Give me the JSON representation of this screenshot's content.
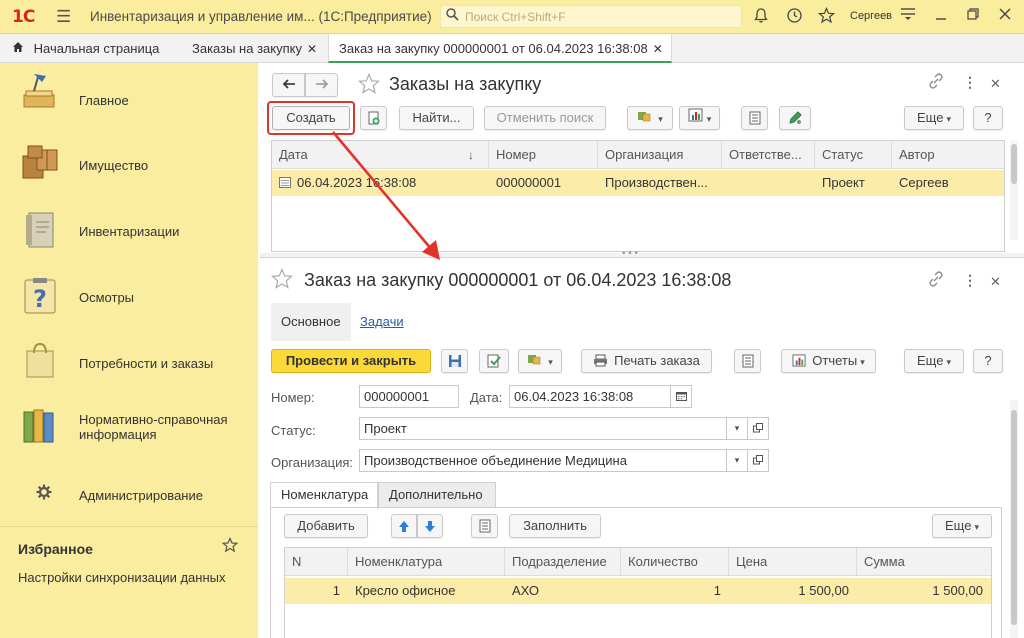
{
  "topbar": {
    "logo": "1С",
    "title": "Инвентаризация и управление им...  (1С:Предприятие)",
    "search_placeholder": "Поиск Ctrl+Shift+F",
    "user": "Сергеев"
  },
  "tabs": [
    {
      "label": "Начальная страница"
    },
    {
      "label": "Заказы на закупку"
    },
    {
      "label": "Заказ на закупку 000000001 от 06.04.2023 16:38:08"
    }
  ],
  "sidebar": {
    "items": [
      {
        "label": "Главное",
        "icon": "desk-lamp-icon"
      },
      {
        "label": "Имущество",
        "icon": "boxes-icon"
      },
      {
        "label": "Инвентаризации",
        "icon": "binder-icon"
      },
      {
        "label": "Осмотры",
        "icon": "question-clipboard-icon"
      },
      {
        "label": "Потребности и заказы",
        "icon": "shopping-bag-icon"
      },
      {
        "label": "Нормативно-справочная информация",
        "icon": "folders-icon"
      },
      {
        "label": "Администрирование",
        "icon": "gear-icon"
      }
    ],
    "favorites_title": "Избранное",
    "favorites_link": "Настройки синхронизации данных"
  },
  "list_form": {
    "title": "Заказы на закупку",
    "create_label": "Создать",
    "find_label": "Найти...",
    "cancel_search_label": "Отменить поиск",
    "more_label": "Еще",
    "help_label": "?",
    "columns": [
      "Дата",
      "Номер",
      "Организация",
      "Ответстве...",
      "Статус",
      "Автор"
    ],
    "rows": [
      [
        "06.04.2023 16:38:08",
        "000000001",
        "Производствен...",
        "",
        "Проект",
        "Сергеев"
      ]
    ]
  },
  "doc_form": {
    "title": "Заказ на закупку 000000001 от 06.04.2023 16:38:08",
    "nav_main": "Основное",
    "nav_tasks": "Задачи",
    "post_close_label": "Провести и закрыть",
    "print_label": "Печать заказа",
    "reports_label": "Отчеты",
    "more_label": "Еще",
    "help_label": "?",
    "number_label": "Номер:",
    "number_value": "000000001",
    "date_label": "Дата:",
    "date_value": "06.04.2023 16:38:08",
    "status_label": "Статус:",
    "status_value": "Проект",
    "org_label": "Организация:",
    "org_value": "Производственное объединение Медицина",
    "subtabs": [
      "Номенклатура",
      "Дополнительно"
    ],
    "add_label": "Добавить",
    "fill_label": "Заполнить",
    "table_more_label": "Еще",
    "columns": [
      "N",
      "Номенклатура",
      "Подразделение",
      "Количество",
      "Цена",
      "Сумма"
    ],
    "rows": [
      [
        "1",
        "Кресло офисное",
        "АХО",
        "1",
        "1 500,00",
        "1 500,00"
      ]
    ]
  },
  "colors": {
    "sidebar_bg": "#fbeda0",
    "topbar_bg": "#fbed9e",
    "selected_row": "#fcecaa",
    "accent_yellow": "#fbd939",
    "annotation_red": "#e0332a",
    "active_tab_underline": "#3aa35b"
  }
}
